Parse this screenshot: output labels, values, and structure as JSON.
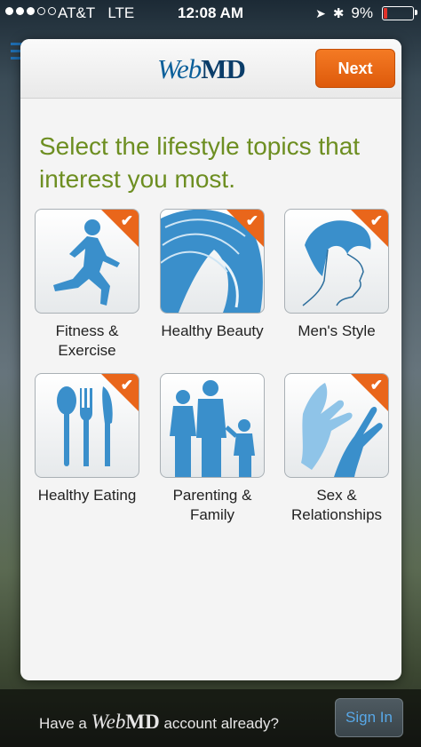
{
  "status": {
    "carrier": "AT&T",
    "network": "LTE",
    "time": "12:08 AM",
    "battery": "9%"
  },
  "header": {
    "logo_web": "Web",
    "logo_md": "MD",
    "next_label": "Next"
  },
  "heading": "Select the lifestyle topics that interest you most.",
  "topics": [
    {
      "label_line1": "Fitness &",
      "label_line2": "Exercise",
      "icon": "runner-icon",
      "selected": true
    },
    {
      "label_line1": "Healthy Beauty",
      "label_line2": "",
      "icon": "hair-beauty-icon",
      "selected": true
    },
    {
      "label_line1": "Men's Style",
      "label_line2": "",
      "icon": "mens-profile-icon",
      "selected": true
    },
    {
      "label_line1": "Healthy Eating",
      "label_line2": "",
      "icon": "utensils-icon",
      "selected": true
    },
    {
      "label_line1": "Parenting &",
      "label_line2": "Family",
      "icon": "family-icon",
      "selected": false
    },
    {
      "label_line1": "Sex &",
      "label_line2": "Relationships",
      "icon": "hands-icon",
      "selected": true
    }
  ],
  "bottom": {
    "text_before": "Have a",
    "logo_web": "Web",
    "logo_md": "MD",
    "text_after": "account already?",
    "signin_label": "Sign In"
  },
  "colors": {
    "accent_orange": "#e9661b",
    "heading_green": "#6d8e21",
    "icon_blue": "#3a8fcb"
  }
}
